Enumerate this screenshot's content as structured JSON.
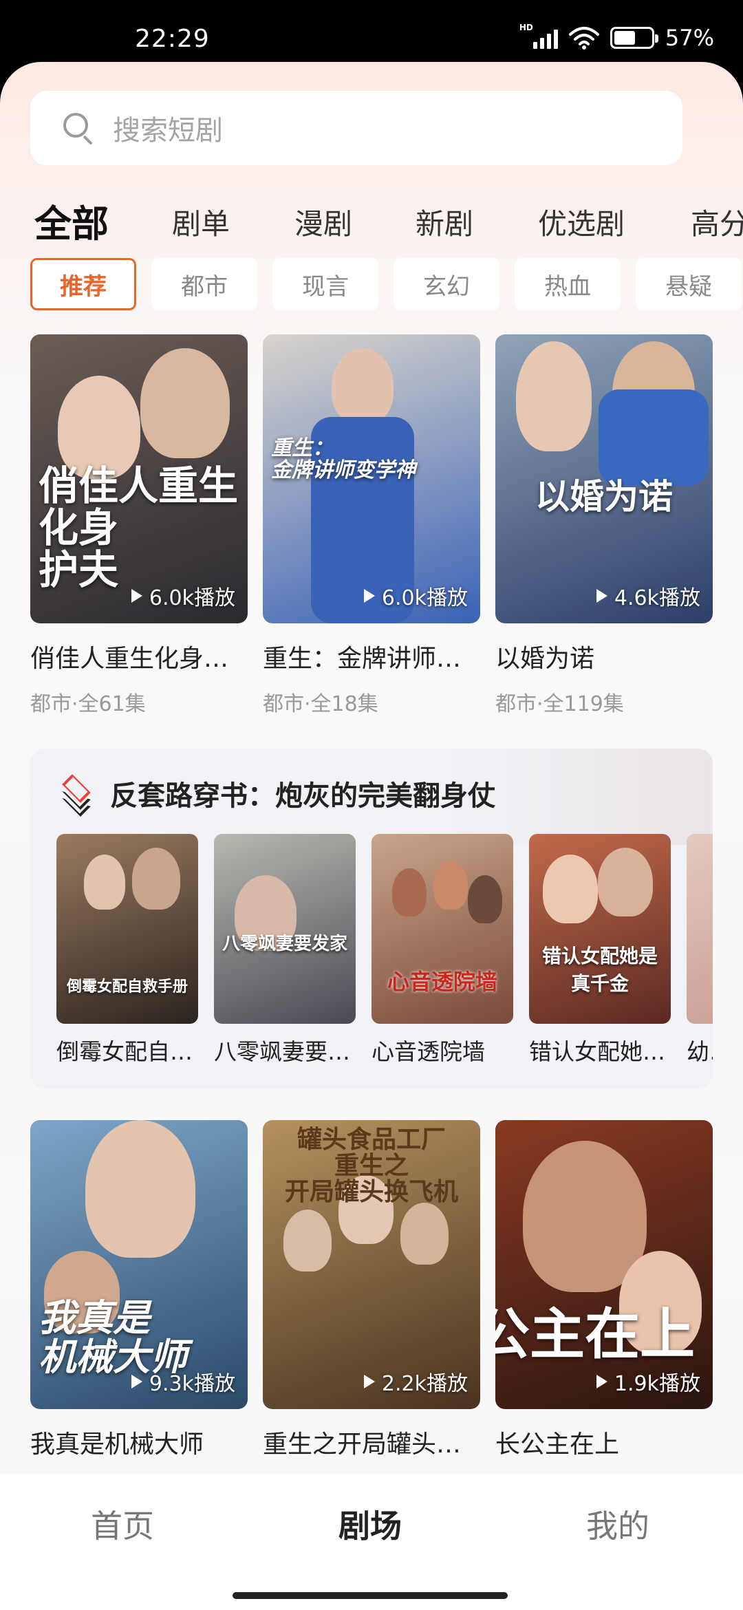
{
  "status_bar": {
    "time": "22:29",
    "battery": "57%",
    "battery_level": 0.57,
    "network": "HD"
  },
  "search": {
    "placeholder": "搜索短剧"
  },
  "category_tabs": [
    "全部",
    "剧单",
    "漫剧",
    "新剧",
    "优选剧",
    "高分"
  ],
  "category_active": "全部",
  "genre_tabs": [
    "推荐",
    "都市",
    "现言",
    "玄幻",
    "热血",
    "悬疑"
  ],
  "genre_active": "推荐",
  "row1": [
    {
      "title": "俏佳人重生化身…",
      "meta": "都市·全61集",
      "plays": "6.0k播放",
      "poster_text": "俏佳人重生\n化身\n护夫",
      "colors": [
        "#6b5c55",
        "#2a2a30"
      ]
    },
    {
      "title": "重生：金牌讲师…",
      "meta": "都市·全18集",
      "plays": "6.0k播放",
      "poster_text": "重生：\n金牌讲师变学神",
      "colors": [
        "#d9d4cc",
        "#3a63b7"
      ]
    },
    {
      "title": "以婚为诺",
      "meta": "都市·全119集",
      "plays": "4.6k播放",
      "poster_text": "以婚为诺",
      "colors": [
        "#8fa3b8",
        "#2d3f6a"
      ]
    }
  ],
  "collection": {
    "title": "反套路穿书：炮灰的完美翻身仗",
    "items": [
      {
        "title": "倒霉女配自…",
        "poster_text": "倒霉女配自救手册",
        "colors": [
          "#9b7b5e",
          "#2c2420"
        ]
      },
      {
        "title": "八零飒妻要…",
        "poster_text": "八零飒妻要发家",
        "colors": [
          "#b8b8b0",
          "#4a4a55"
        ]
      },
      {
        "title": "心音透院墙",
        "poster_text": "心音透院墙",
        "colors": [
          "#c9a58b",
          "#7a4a3a"
        ]
      },
      {
        "title": "错认女配她…",
        "poster_text": "错认女配她是真千金",
        "colors": [
          "#c26a4a",
          "#5b2a22"
        ]
      },
      {
        "title": "幼…",
        "poster_text": "",
        "colors": [
          "#e6c9c2",
          "#c59a90"
        ]
      }
    ]
  },
  "row2": [
    {
      "title": "我真是机械大师",
      "plays": "9.3k播放",
      "poster_text": "我真是\n机械大师",
      "colors": [
        "#7ea6c8",
        "#2b4a6a"
      ]
    },
    {
      "title": "重生之开局罐头…",
      "plays": "2.2k播放",
      "poster_text": "罐头食品工厂\n重生之\n开局罐头换飞机",
      "colors": [
        "#b5915e",
        "#4a3420"
      ]
    },
    {
      "title": "长公主在上",
      "plays": "1.9k播放",
      "poster_text": "公主在上",
      "colors": [
        "#8a3a22",
        "#2a1510"
      ]
    }
  ],
  "bottom_nav": [
    "首页",
    "剧场",
    "我的"
  ],
  "bottom_nav_active": "剧场",
  "accent_color": "#e8652c"
}
